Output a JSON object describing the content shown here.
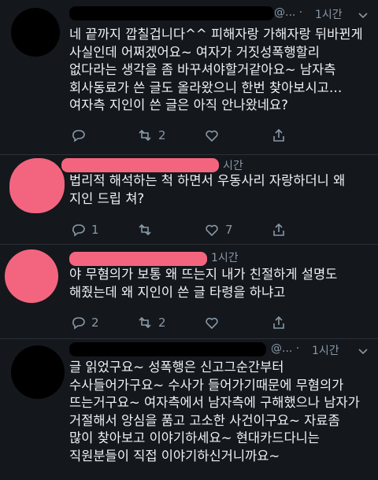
{
  "tweets": [
    {
      "header_suffix": "@... ·",
      "time": "1시간",
      "text": "네 끝까지 깝칠겁니다^^ 피해자랑 가해자랑 뒤바뀐게 사실인데 어쩌겠어요~ 여자가 거짓성폭행할리 없다라는 생각을 좀 바꾸셔야할거같아요~ 남자측 회사동료가 쓴 글도 올라왔으니 한번 찾아보시고…여자측 지인이 쓴 글은 아직 안나왔네요?",
      "reply_count": "",
      "retweet_count": "2",
      "like_count": ""
    },
    {
      "header_suffix": "",
      "time": "시간",
      "text": "법리적 해석하는 척 하면서 우동사리 자랑하더니 왜 지인 드립 쳐?",
      "reply_count": "1",
      "retweet_count": "",
      "like_count": "7"
    },
    {
      "header_suffix": "",
      "time": "1시간",
      "text": "야 무혐의가 보통 왜 뜨는지 내가 친절하게 설명도 해줬는데 왜 지인이 쓴 글 타령을 하냐고",
      "reply_count": "2",
      "retweet_count": "2",
      "like_count": ""
    },
    {
      "header_suffix": "@... ·",
      "time": "1시간",
      "text": "글 읽었구요~ 성폭행은 신고그순간부터 수사들어가구요~ 수사가 들어가기때문에 무혐의가 뜨는거구요~ 여자측에서 남자측에 구해했으나 남자가 거절해서 앙심을 품고 고소한 사건이구요~ 자료좀 많이 찾아보고 이야기하세요~ 현대카드다니는 직원분들이 직접 이야기하신거니까요~",
      "reply_count": "",
      "retweet_count": "",
      "like_count": ""
    }
  ],
  "icons": {
    "reply": "reply-icon",
    "retweet": "retweet-icon",
    "like": "like-icon",
    "share": "share-icon"
  },
  "colors": {
    "background": "#14171c",
    "redaction_pink": "#f3657f",
    "redaction_black": "#000000",
    "muted": "#8899a6"
  }
}
